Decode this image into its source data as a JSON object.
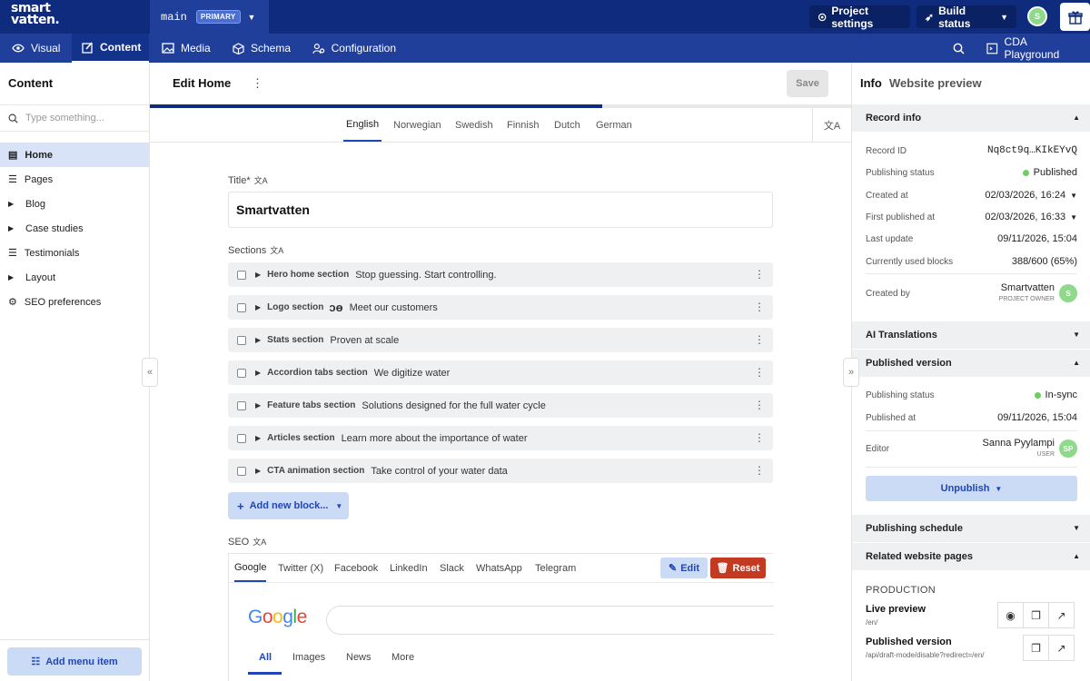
{
  "brand": {
    "logo_line1": "smart",
    "logo_line2": "vatten."
  },
  "branch": {
    "name": "main",
    "badge": "PRIMARY"
  },
  "topbar": {
    "project_settings": "Project settings",
    "build_status": "Build status",
    "user_initial": "S"
  },
  "nav": {
    "items": [
      {
        "label": "Visual",
        "icon": "eye-icon"
      },
      {
        "label": "Content",
        "icon": "pencil-square-icon",
        "active": true
      },
      {
        "label": "Media",
        "icon": "image-icon"
      },
      {
        "label": "Schema",
        "icon": "cube-icon"
      },
      {
        "label": "Configuration",
        "icon": "gear-users-icon"
      }
    ],
    "cda_playground": "CDA Playground"
  },
  "sidebar": {
    "title": "Content",
    "search_placeholder": "Type something...",
    "items": [
      {
        "label": "Home",
        "icon": "document-icon",
        "active": true
      },
      {
        "label": "Pages",
        "icon": "list-icon"
      },
      {
        "label": "Blog",
        "icon": "caret-right-icon"
      },
      {
        "label": "Case studies",
        "icon": "caret-right-icon"
      },
      {
        "label": "Testimonials",
        "icon": "list-icon"
      },
      {
        "label": "Layout",
        "icon": "caret-right-icon"
      },
      {
        "label": "SEO preferences",
        "icon": "settings-icon"
      }
    ],
    "add_menu_item": "Add menu item"
  },
  "editor": {
    "title": "Edit Home",
    "save_label": "Save",
    "progress_fraction": 0.645,
    "languages": [
      "English",
      "Norwegian",
      "Swedish",
      "Finnish",
      "Dutch",
      "German"
    ],
    "active_language": "English",
    "title_label": "Title*",
    "title_value": "Smartvatten",
    "sections_label": "Sections",
    "blocks": [
      {
        "name": "Hero home section",
        "text": "Stop guessing. Start controlling."
      },
      {
        "name": "Logo section",
        "text": "Meet our customers"
      },
      {
        "name": "Stats section",
        "text": "Proven at scale"
      },
      {
        "name": "Accordion tabs section",
        "text": "We digitize water"
      },
      {
        "name": "Feature tabs section",
        "text": "Solutions designed for the full water cycle"
      },
      {
        "name": "Articles section",
        "text": "Learn more about the importance of water"
      },
      {
        "name": "CTA animation section",
        "text": "Take control of your water data"
      }
    ],
    "add_block_label": "Add new block...",
    "seo_label": "SEO",
    "seo_tabs": [
      "Google",
      "Twitter (X)",
      "Facebook",
      "LinkedIn",
      "Slack",
      "WhatsApp",
      "Telegram"
    ],
    "edit_label": "Edit",
    "reset_label": "Reset",
    "google_logo": "Google",
    "google_tabs": [
      "All",
      "Images",
      "News",
      "More"
    ]
  },
  "info": {
    "tabs": [
      "Info",
      "Website preview"
    ],
    "record_info": {
      "title": "Record info",
      "rows": [
        {
          "k": "Record ID",
          "v": "Nq8ct9q…KIkEYvQ"
        },
        {
          "k": "Publishing status",
          "v": "Published"
        },
        {
          "k": "Created at",
          "v": "02/03/2026, 16:24"
        },
        {
          "k": "First published at",
          "v": "02/03/2026, 16:33"
        },
        {
          "k": "Last update",
          "v": "09/11/2026, 15:04"
        },
        {
          "k": "Currently used blocks",
          "v": "388/600 (65%)"
        }
      ],
      "created_by_label": "Created by",
      "created_by_name": "Smartvatten",
      "created_by_role": "PROJECT OWNER",
      "created_by_initial": "S"
    },
    "ai_translations": "AI Translations",
    "published_version": {
      "title": "Published version",
      "status_label": "Publishing status",
      "status_value": "In-sync",
      "published_at_label": "Published at",
      "published_at_value": "09/11/2026, 15:04",
      "editor_label": "Editor",
      "editor_name": "Sanna Pyylampi",
      "editor_role": "USER",
      "editor_initials": "SP"
    },
    "unpublish_label": "Unpublish",
    "publishing_schedule": "Publishing schedule",
    "related_pages": "Related website pages",
    "production_label": "PRODUCTION",
    "live_preview": {
      "title": "Live preview",
      "path": "/en/"
    },
    "published_link": {
      "title": "Published version",
      "path": "/api/draft-mode/disable?redirect=/en/"
    }
  },
  "colors": {
    "navy": "#0e2b7e",
    "nav_blue": "#1f3f9a",
    "accent": "#1f46b8",
    "reset_red": "#c33a22",
    "status_green": "#6ccf5e"
  }
}
